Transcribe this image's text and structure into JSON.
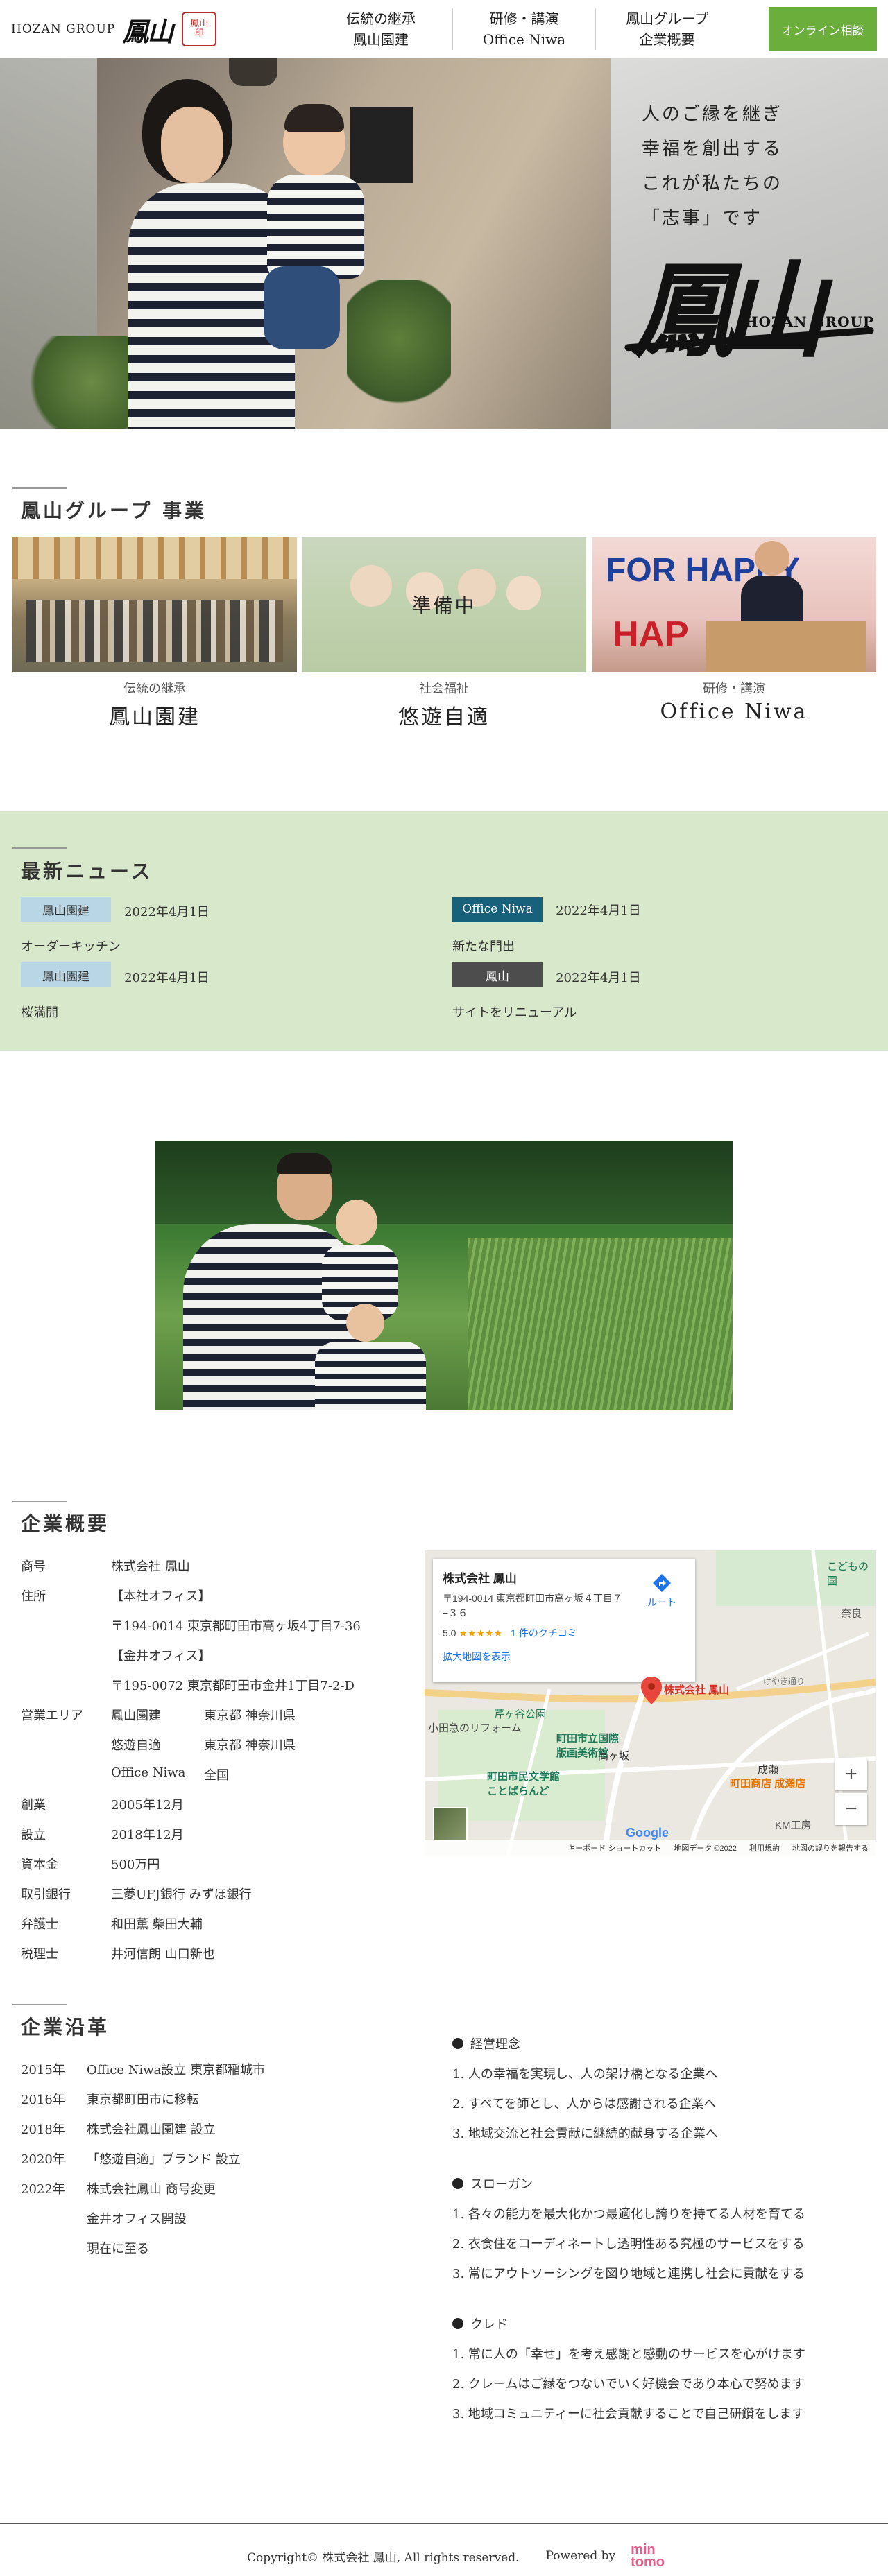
{
  "header": {
    "logo_en": "HOZAN GROUP",
    "logo_kanji": "鳳山",
    "seal_line1": "鳳山",
    "seal_line2": "印",
    "nav": [
      {
        "line1": "伝統の継承",
        "line2": "鳳山園建"
      },
      {
        "line1": "研修・講演",
        "line2": "Office Niwa"
      },
      {
        "line1": "鳳山グループ",
        "line2": "企業概要"
      }
    ],
    "consult_label": "オンライン相談"
  },
  "hero": {
    "copy": [
      "人のご縁を継ぎ",
      "幸福を創出する",
      "これが私たちの",
      "「志事」です"
    ],
    "brand_kanji": "鳳山",
    "brand_en": "HOZAN GROUP"
  },
  "business": {
    "title": "鳳山グループ 事業",
    "cards": [
      {
        "sub": "伝統の継承",
        "name": "鳳山園建"
      },
      {
        "sub": "社会福祉",
        "name": "悠遊自適",
        "overlay": "準備中"
      },
      {
        "sub": "研修・講演",
        "name": "Office Niwa",
        "banner1": "FOR HAPPY",
        "banner2": "HAP"
      }
    ]
  },
  "news": {
    "title": "最新ニュース",
    "items": [
      {
        "badge": "鳳山園建",
        "date": "2022年4月1日",
        "title": "オーダーキッチン"
      },
      {
        "badge": "Office Niwa",
        "date": "2022年4月1日",
        "title": "新たな門出"
      },
      {
        "badge": "鳳山園建",
        "date": "2022年4月1日",
        "title": "桜満開"
      },
      {
        "badge": "鳳山",
        "date": "2022年4月1日",
        "title": "サイトをリニューアル"
      }
    ]
  },
  "company": {
    "title": "企業概要",
    "rows": [
      {
        "label": "商号",
        "v1": "株式会社 鳳山",
        "v2": ""
      },
      {
        "label": "住所",
        "v1": "【本社オフィス】",
        "v2": ""
      },
      {
        "label": "",
        "v1": "〒194-0014 東京都町田市高ヶ坂4丁目7-36",
        "v2": ""
      },
      {
        "label": "",
        "v1": "【金井オフィス】",
        "v2": ""
      },
      {
        "label": "",
        "v1": "〒195-0072 東京都町田市金井1丁目7-2-D",
        "v2": ""
      },
      {
        "label": "営業エリア",
        "v1": "鳳山園建",
        "v2": "東京都 神奈川県"
      },
      {
        "label": "",
        "v1": "悠遊自適",
        "v2": "東京都 神奈川県"
      },
      {
        "label": "",
        "v1": "Office Niwa",
        "v2": "全国"
      },
      {
        "label": "創業",
        "v1": "2005年12月",
        "v2": ""
      },
      {
        "label": "設立",
        "v1": "2018年12月",
        "v2": ""
      },
      {
        "label": "資本金",
        "v1": "500万円",
        "v2": ""
      },
      {
        "label": "取引銀行",
        "v1": "三菱UFJ銀行 みずほ銀行",
        "v2": ""
      },
      {
        "label": "弁護士",
        "v1": "和田薫 柴田大輔",
        "v2": ""
      },
      {
        "label": "税理士",
        "v1": "井河信朗 山口新也",
        "v2": ""
      }
    ]
  },
  "map": {
    "name": "株式会社 鳳山",
    "address": "〒194-0014 東京都町田市高ヶ坂４丁目７−３６",
    "rating": "5.0",
    "stars": "★★★★★",
    "reviews": "1 件のクチコミ",
    "enlarge": "拡大地図を表示",
    "route": "ルート",
    "labels": {
      "pin": "株式会社 鳳山",
      "reform": "小田急のリフォーム",
      "museum": "町田市立国際\n版画美術館",
      "library": "町田市民文学館\nことばらんど",
      "takagasaka": "高ヶ坂",
      "seriga": "芹ヶ谷公園",
      "naruse": "成瀬",
      "kodomo": "こどもの国",
      "nara": "奈良",
      "shopping": "町田商店 成瀬店",
      "km": "KM工房",
      "keyaki": "けやき通り",
      "google": "Google"
    },
    "footer": [
      "キーボード ショートカット",
      "地図データ ©2022",
      "利用規約",
      "地図の誤りを報告する"
    ],
    "zoom_in": "+",
    "zoom_out": "−"
  },
  "history": {
    "title": "企業沿革",
    "rows": [
      {
        "year": "2015年",
        "text": "Office Niwa設立 東京都稲城市"
      },
      {
        "year": "2016年",
        "text": "東京都町田市に移転"
      },
      {
        "year": "2018年",
        "text": "株式会社鳳山園建 設立"
      },
      {
        "year": "2020年",
        "text": "「悠遊自適」ブランド 設立"
      },
      {
        "year": "2022年",
        "text": "株式会社鳳山 商号変更"
      },
      {
        "year": "",
        "text": "金井オフィス開設"
      },
      {
        "year": "",
        "text": "現在に至る"
      }
    ]
  },
  "philosophy": [
    {
      "head": "経営理念",
      "items": [
        "1. 人の幸福を実現し、人の架け橋となる企業へ",
        "2. すべてを師とし、人からは感謝される企業へ",
        "3. 地域交流と社会貢献に継続的献身する企業へ"
      ]
    },
    {
      "head": "スローガン",
      "items": [
        "1. 各々の能力を最大化かつ最適化し誇りを持てる人材を育てる",
        "2. 衣食住をコーディネートし透明性ある究極のサービスをする",
        "3. 常にアウトソーシングを図り地域と連携し社会に貢献をする"
      ]
    },
    {
      "head": "クレド",
      "items": [
        "1. 常に人の「幸せ」を考え感謝と感動のサービスを心がけます",
        "2. クレームはご縁をつないでいく好機会であり本心で努めます",
        "3. 地域コミュニティーに社会貢献することで自己研鑽をします"
      ]
    }
  ],
  "footer": {
    "copyright": "Copyright© 株式会社 鳳山, All rights reserved.",
    "powered": "Powered by",
    "logo_top": "min",
    "logo_bottom": "tomo"
  }
}
